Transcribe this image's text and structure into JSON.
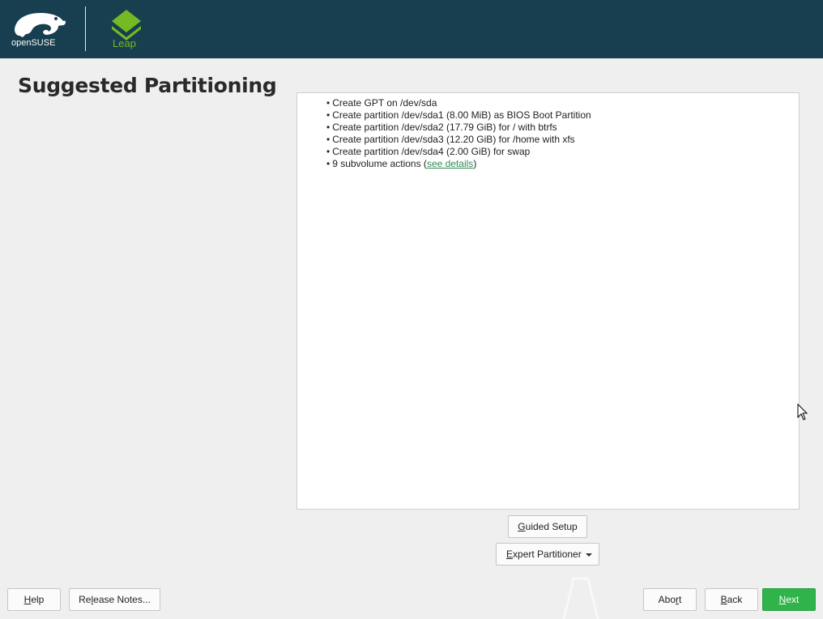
{
  "header": {
    "brand_text": "openSUSE",
    "product_text": "Leap",
    "brand_color": "#173f4f",
    "accent_color": "#73ba25"
  },
  "page": {
    "title": "Suggested Partitioning"
  },
  "summary": {
    "items": [
      "Create GPT on /dev/sda",
      "Create partition /dev/sda1 (8.00 MiB) as BIOS Boot Partition",
      "Create partition /dev/sda2 (17.79 GiB) for / with btrfs",
      "Create partition /dev/sda3 (12.20 GiB) for /home with xfs",
      "Create partition /dev/sda4 (2.00 GiB) for swap"
    ],
    "subvolume_prefix": "9 subvolume actions (",
    "subvolume_link": "see details",
    "subvolume_suffix": ")"
  },
  "buttons": {
    "guided_setup": {
      "mnemonic": "G",
      "rest": "uided Setup"
    },
    "expert_partitioner": {
      "mnemonic": "E",
      "rest": "xpert Partitioner"
    },
    "help": {
      "mnemonic": "H",
      "rest": "elp"
    },
    "release_notes": {
      "pre": "Re",
      "mnemonic": "l",
      "rest": "ease Notes..."
    },
    "abort": {
      "pre": "Abo",
      "mnemonic": "r",
      "rest": "t"
    },
    "back": {
      "mnemonic": "B",
      "rest": "ack"
    },
    "next": {
      "mnemonic": "N",
      "rest": "ext"
    },
    "next_color": "#30b34a"
  },
  "icons": {
    "brand_logo": "opensuse-chameleon-icon",
    "product_logo": "leap-layers-icon",
    "dropdown": "chevron-down-icon",
    "pointer": "mouse-pointer-icon"
  }
}
